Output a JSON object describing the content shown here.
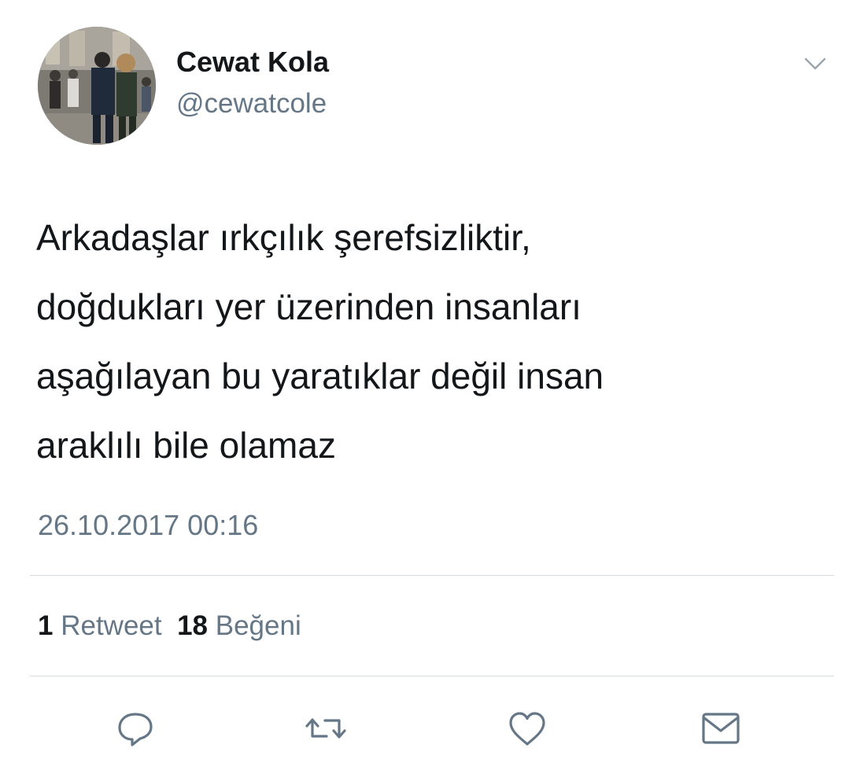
{
  "tweet": {
    "author": {
      "display_name": "Cewat Kola",
      "handle": "@cewatcole"
    },
    "text_lines": [
      "Arkadaşlar ırkçılık şerefsizliktir,",
      "doğdukları yer üzerinden insanları",
      "aşağılayan bu yaratıklar değil insan",
      "araklılı bile olamaz"
    ],
    "timestamp": "26.10.2017 00:16",
    "stats": {
      "retweets": "1",
      "retweets_label": "Retweet",
      "likes": "18",
      "likes_label": "Beğeni"
    },
    "actions": {
      "reply_icon": "reply-icon",
      "retweet_icon": "retweet-icon",
      "like_icon": "heart-icon",
      "message_icon": "envelope-icon"
    }
  },
  "colors": {
    "text_primary": "#14171a",
    "text_secondary": "#657786",
    "divider": "#d8dde2",
    "icon": "#657786"
  }
}
